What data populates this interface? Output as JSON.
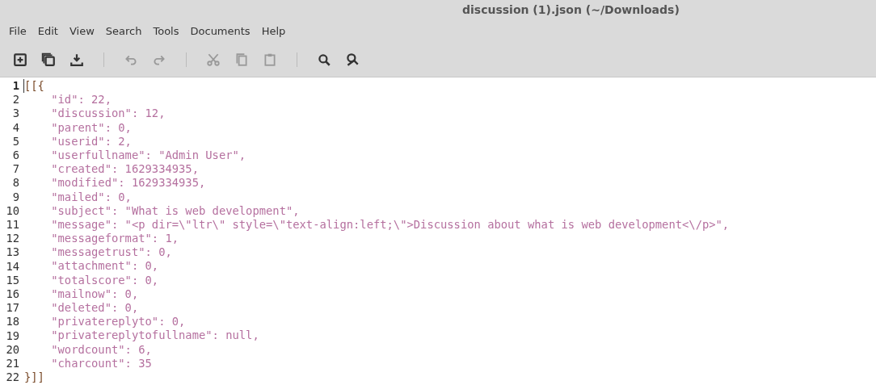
{
  "window": {
    "title": "discussion (1).json (~/Downloads)"
  },
  "menu": [
    "File",
    "Edit",
    "View",
    "Search",
    "Tools",
    "Documents",
    "Help"
  ],
  "toolbar": [
    {
      "kind": "new"
    },
    {
      "kind": "open"
    },
    {
      "kind": "save"
    },
    {
      "kind": "sep"
    },
    {
      "kind": "undo"
    },
    {
      "kind": "redo"
    },
    {
      "kind": "sep"
    },
    {
      "kind": "cut"
    },
    {
      "kind": "copy"
    },
    {
      "kind": "paste"
    },
    {
      "kind": "sep"
    },
    {
      "kind": "find"
    },
    {
      "kind": "replace"
    }
  ],
  "editor": {
    "lines": [
      {
        "number": "1",
        "current": true,
        "kind": "bracket",
        "text": "[[{"
      },
      {
        "number": "2",
        "current": false,
        "kind": "entry",
        "text": "    \"id\": 22,"
      },
      {
        "number": "3",
        "current": false,
        "kind": "entry",
        "text": "    \"discussion\": 12,"
      },
      {
        "number": "4",
        "current": false,
        "kind": "entry",
        "text": "    \"parent\": 0,"
      },
      {
        "number": "5",
        "current": false,
        "kind": "entry",
        "text": "    \"userid\": 2,"
      },
      {
        "number": "6",
        "current": false,
        "kind": "entry",
        "text": "    \"userfullname\": \"Admin User\","
      },
      {
        "number": "7",
        "current": false,
        "kind": "entry",
        "text": "    \"created\": 1629334935,"
      },
      {
        "number": "8",
        "current": false,
        "kind": "entry",
        "text": "    \"modified\": 1629334935,"
      },
      {
        "number": "9",
        "current": false,
        "kind": "entry",
        "text": "    \"mailed\": 0,"
      },
      {
        "number": "10",
        "current": false,
        "kind": "entry",
        "text": "    \"subject\": \"What is web development\","
      },
      {
        "number": "11",
        "current": false,
        "kind": "entry",
        "text": "    \"message\": \"<p dir=\\\"ltr\\\" style=\\\"text-align:left;\\\">Discussion about what is web development<\\/p>\","
      },
      {
        "number": "12",
        "current": false,
        "kind": "entry",
        "text": "    \"messageformat\": 1,"
      },
      {
        "number": "13",
        "current": false,
        "kind": "entry",
        "text": "    \"messagetrust\": 0,"
      },
      {
        "number": "14",
        "current": false,
        "kind": "entry",
        "text": "    \"attachment\": 0,"
      },
      {
        "number": "15",
        "current": false,
        "kind": "entry",
        "text": "    \"totalscore\": 0,"
      },
      {
        "number": "16",
        "current": false,
        "kind": "entry",
        "text": "    \"mailnow\": 0,"
      },
      {
        "number": "17",
        "current": false,
        "kind": "entry",
        "text": "    \"deleted\": 0,"
      },
      {
        "number": "18",
        "current": false,
        "kind": "entry",
        "text": "    \"privatereplyto\": 0,"
      },
      {
        "number": "19",
        "current": false,
        "kind": "entry",
        "text": "    \"privatereplytofullname\": null,"
      },
      {
        "number": "20",
        "current": false,
        "kind": "entry",
        "text": "    \"wordcount\": 6,"
      },
      {
        "number": "21",
        "current": false,
        "kind": "entry",
        "text": "    \"charcount\": 35"
      },
      {
        "number": "22",
        "current": false,
        "kind": "bracket",
        "text": "}]]"
      }
    ]
  }
}
